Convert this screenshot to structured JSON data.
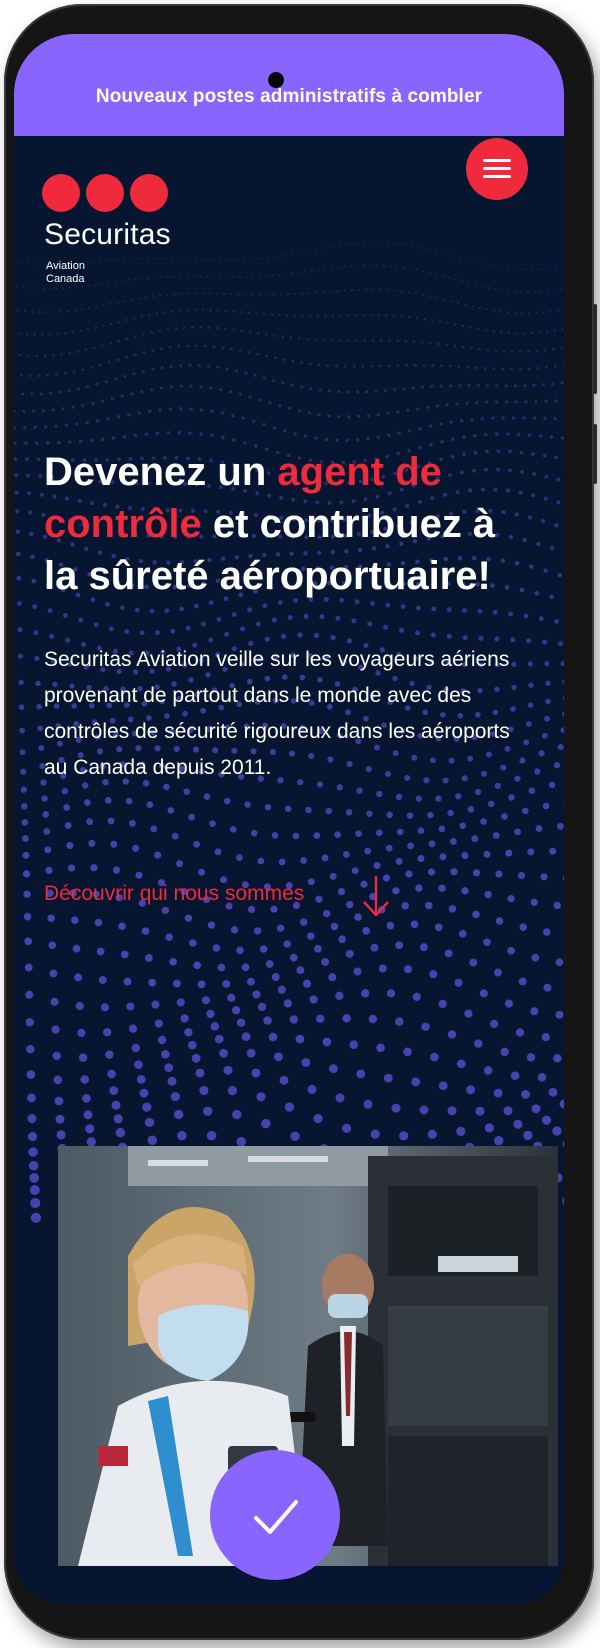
{
  "announcement": {
    "text": "Nouveaux postes administratifs à combler"
  },
  "brand": {
    "name": "Securitas",
    "sub_line1": "Aviation",
    "sub_line2": "Canada",
    "color_red": "#ee2a3c",
    "color_purple": "#8a64ff",
    "color_navy": "#061630"
  },
  "nav": {
    "menu_icon": "hamburger-icon"
  },
  "hero": {
    "title_part1": "Devenez un ",
    "title_highlight": "agent de contrôle",
    "title_part2": " et contribuez à la sûreté aéroportuaire!",
    "description": "Securitas Aviation veille sur les voyageurs aériens provenant de partout dans le monde avec des contrôles de sécurité rigoureux dans les aéroports au Canada depuis 2011.",
    "cta_label": "Découvrir qui nous sommes",
    "cta_icon": "arrow-down-icon"
  },
  "feature": {
    "badge_icon": "checkmark-icon"
  }
}
